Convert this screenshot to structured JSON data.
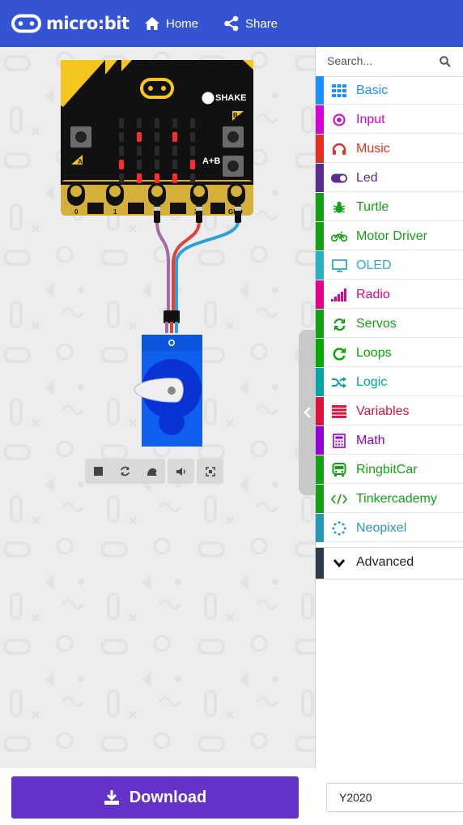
{
  "header": {
    "logo_text": "micro:bit",
    "home_label": "Home",
    "share_label": "Share"
  },
  "simulator": {
    "shake_label": "SHAKE",
    "ab_label": "A+B",
    "button_a": "A",
    "button_b": "B",
    "pins": [
      "0",
      "1",
      "2",
      "3V",
      "GND"
    ],
    "led_matrix": [
      [
        0,
        0,
        0,
        0,
        0
      ],
      [
        0,
        1,
        0,
        1,
        0
      ],
      [
        0,
        0,
        0,
        0,
        0
      ],
      [
        1,
        0,
        0,
        0,
        1
      ],
      [
        0,
        1,
        1,
        1,
        0
      ]
    ],
    "led_color": "#ff2a2a",
    "toolbar_icons": [
      "stop-icon",
      "restart-icon",
      "slow-mo-icon",
      "mute-icon",
      "fullscreen-icon"
    ]
  },
  "toolbox": {
    "search_placeholder": "Search...",
    "categories": [
      {
        "label": "Basic",
        "color": "#1e90ff",
        "icon": "grid-icon"
      },
      {
        "label": "Input",
        "color": "#d400d4",
        "icon": "radio-button-icon"
      },
      {
        "label": "Music",
        "color": "#e63022",
        "icon": "headphones-icon"
      },
      {
        "label": "Led",
        "color": "#5c2d91",
        "icon": "toggle-icon"
      },
      {
        "label": "Turtle",
        "color": "#14a214",
        "icon": "bug-icon"
      },
      {
        "label": "Motor Driver",
        "color": "#14a214",
        "icon": "motorcycle-icon"
      },
      {
        "label": "OLED",
        "color": "#2ab0c2",
        "icon": "monitor-icon"
      },
      {
        "label": "Radio",
        "color": "#e3008c",
        "icon": "signal-bars-icon"
      },
      {
        "label": "Servos",
        "color": "#14a214",
        "icon": "sync-icon"
      },
      {
        "label": "Loops",
        "color": "#00aa00",
        "icon": "redo-icon"
      },
      {
        "label": "Logic",
        "color": "#00a4a6",
        "icon": "shuffle-icon"
      },
      {
        "label": "Variables",
        "color": "#dc143c",
        "icon": "list-icon"
      },
      {
        "label": "Math",
        "color": "#9400d3",
        "icon": "calculator-icon"
      },
      {
        "label": "RingbitCar",
        "color": "#14a214",
        "icon": "bus-icon"
      },
      {
        "label": "Tinkercademy",
        "color": "#14a214",
        "icon": "code-icon"
      },
      {
        "label": "Neopixel",
        "color": "#2699b4",
        "icon": "dotted-circle-icon"
      }
    ],
    "advanced_label": "Advanced"
  },
  "footer": {
    "download_label": "Download",
    "project_name": "Y2020"
  },
  "colors": {
    "header_bg": "#3454d1",
    "download_bg": "#6232c9",
    "servo_blue": "#1060f0"
  }
}
